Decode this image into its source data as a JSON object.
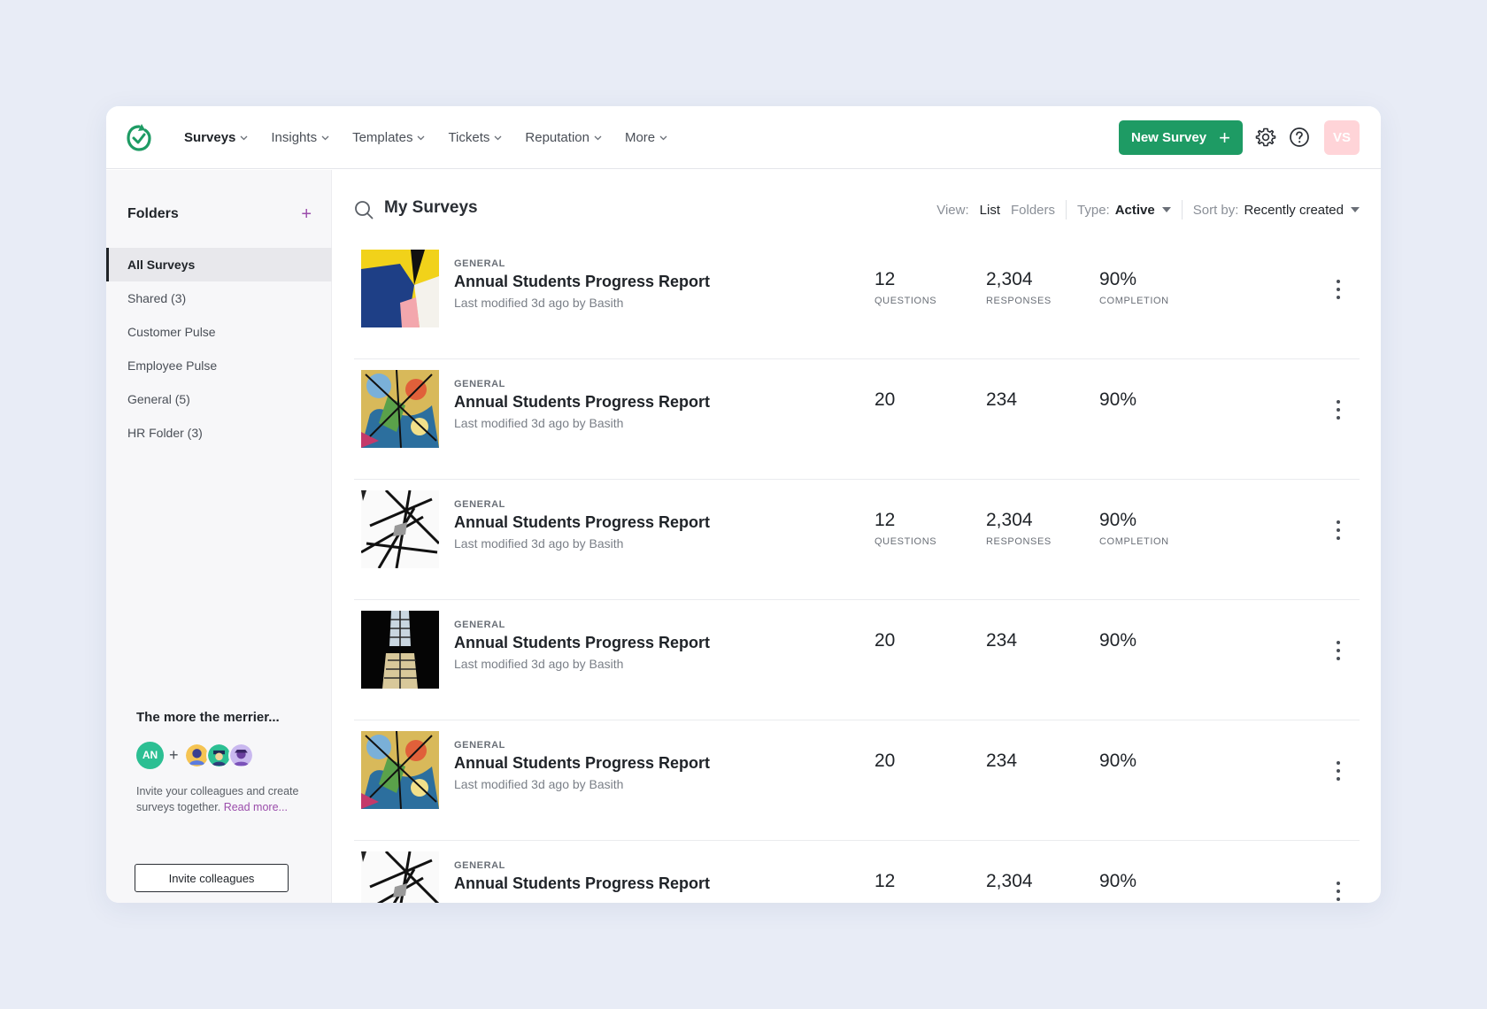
{
  "nav": {
    "items": [
      {
        "label": "Surveys",
        "active": true
      },
      {
        "label": "Insights",
        "active": false
      },
      {
        "label": "Templates",
        "active": false
      },
      {
        "label": "Tickets",
        "active": false
      },
      {
        "label": "Reputation",
        "active": false
      },
      {
        "label": "More",
        "active": false
      }
    ],
    "new_survey_label": "New Survey",
    "new_survey_icon": "+",
    "avatar_initials": "VS"
  },
  "colors": {
    "brand_green": "#1e9b64",
    "accent_purple": "#9b4dab",
    "avatar_pink": "#ffd4d8"
  },
  "sidebar": {
    "title": "Folders",
    "add_icon": "+",
    "folders": [
      {
        "label": "All Surveys",
        "active": true
      },
      {
        "label": "Shared (3)",
        "active": false
      },
      {
        "label": "Customer Pulse",
        "active": false
      },
      {
        "label": "Employee Pulse",
        "active": false
      },
      {
        "label": "General (5)",
        "active": false
      },
      {
        "label": "HR Folder (3)",
        "active": false
      }
    ],
    "invite": {
      "title": "The more the merrier...",
      "avatar_initials": "AN",
      "plus": "+",
      "text": "Invite your colleagues and create surveys together.",
      "read_more": "Read more...",
      "button_label": "Invite colleagues"
    }
  },
  "main": {
    "title": "My Surveys",
    "view": {
      "label": "View:",
      "options": [
        "List",
        "Folders"
      ],
      "selected": "List"
    },
    "type": {
      "label": "Type:",
      "value": "Active"
    },
    "sort": {
      "label": "Sort by:",
      "value": "Recently created"
    },
    "surveys": [
      {
        "thumb": "abstract",
        "category": "GENERAL",
        "title": "Annual Students Progress Report",
        "meta": "Last modified 3d ago by Basith",
        "questions": "12",
        "responses": "2,304",
        "completion": "90%",
        "show_labels": true
      },
      {
        "thumb": "graffiti",
        "category": "GENERAL",
        "title": "Annual Students Progress Report",
        "meta": "Last modified 3d ago by Basith",
        "questions": "20",
        "responses": "234",
        "completion": "90%",
        "show_labels": false
      },
      {
        "thumb": "structure",
        "category": "GENERAL",
        "title": "Annual Students Progress Report",
        "meta": "Last modified 3d ago by Basith",
        "questions": "12",
        "responses": "2,304",
        "completion": "90%",
        "show_labels": true
      },
      {
        "thumb": "window",
        "category": "GENERAL",
        "title": "Annual Students Progress Report",
        "meta": "Last modified 3d ago by Basith",
        "questions": "20",
        "responses": "234",
        "completion": "90%",
        "show_labels": false
      },
      {
        "thumb": "graffiti",
        "category": "GENERAL",
        "title": "Annual Students Progress Report",
        "meta": "Last modified 3d ago by Basith",
        "questions": "20",
        "responses": "234",
        "completion": "90%",
        "show_labels": false
      },
      {
        "thumb": "structure",
        "category": "GENERAL",
        "title": "Annual Students Progress Report",
        "meta": "",
        "questions": "12",
        "responses": "2,304",
        "completion": "90%",
        "show_labels": false
      }
    ],
    "stat_labels": {
      "questions": "QUESTIONS",
      "responses": "RESPONSES",
      "completion": "COMPLETION"
    }
  }
}
